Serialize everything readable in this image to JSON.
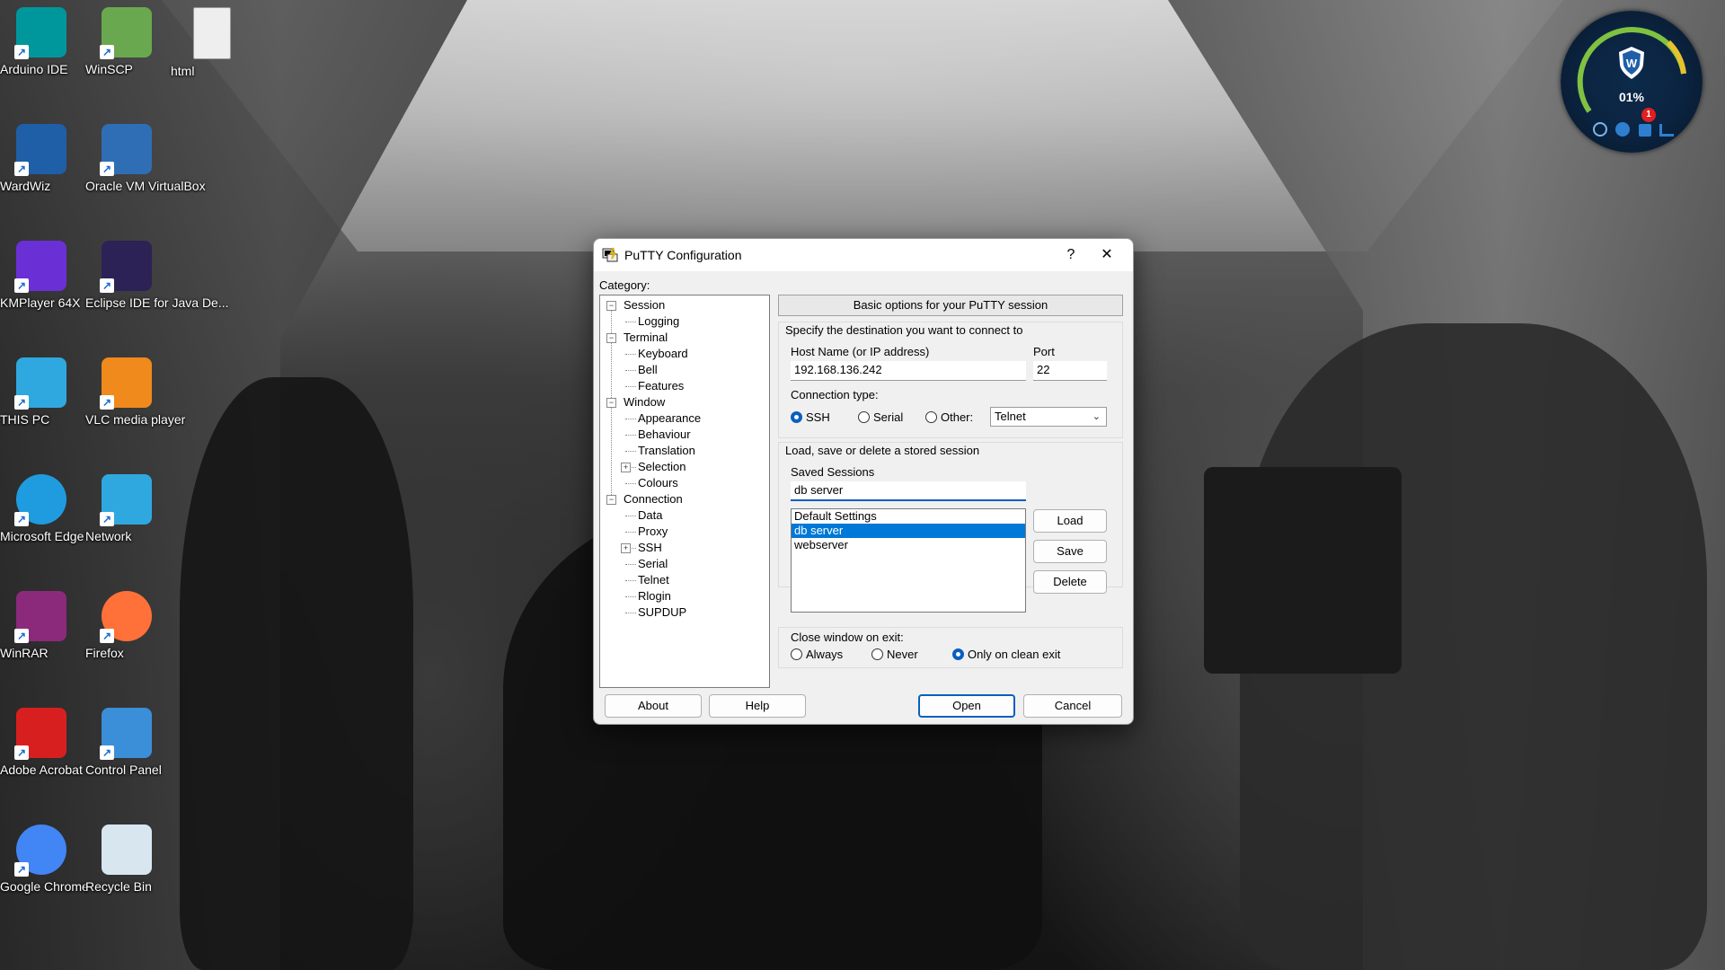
{
  "desktop": {
    "icons": [
      {
        "label": "Arduino IDE",
        "icon": "arduino-icon",
        "color": "#00979c"
      },
      {
        "label": "WinSCP",
        "icon": "winscp-icon",
        "color": "#6aa84f"
      },
      {
        "label": "html",
        "icon": "file-icon",
        "color": "#eeeeee"
      },
      {
        "label": "WardWiz",
        "icon": "wardwiz-shield-icon",
        "color": "#1f5fa8"
      },
      {
        "label": "Oracle VM VirtualBox",
        "icon": "virtualbox-icon",
        "color": "#2f6eb5"
      },
      {
        "label": "KMPlayer 64X",
        "icon": "kmplayer-icon",
        "color": "#6b2fd6"
      },
      {
        "label": "Eclipse IDE for Java De...",
        "icon": "eclipse-icon",
        "color": "#2c2255"
      },
      {
        "label": "THIS PC",
        "icon": "monitor-icon",
        "color": "#2fa8e0"
      },
      {
        "label": "VLC media player",
        "icon": "vlc-cone-icon",
        "color": "#f08a1c"
      },
      {
        "label": "Microsoft Edge",
        "icon": "edge-icon",
        "color": "#1f9be0"
      },
      {
        "label": "Network",
        "icon": "network-icon",
        "color": "#2fa8e0"
      },
      {
        "label": "WinRAR",
        "icon": "winrar-icon",
        "color": "#8b2a7a"
      },
      {
        "label": "Firefox",
        "icon": "firefox-icon",
        "color": "#ff7139"
      },
      {
        "label": "Adobe Acrobat",
        "icon": "acrobat-icon",
        "color": "#d81f1f"
      },
      {
        "label": "Control Panel",
        "icon": "control-panel-icon",
        "color": "#3a8fd8"
      },
      {
        "label": "Google Chrome",
        "icon": "chrome-icon",
        "color": "#4285f4"
      },
      {
        "label": "Recycle Bin",
        "icon": "recycle-bin-icon",
        "color": "#d8e6f0"
      }
    ],
    "shortcut_arrow": "↗"
  },
  "widget": {
    "percent": "01%",
    "badge": "1",
    "icons": [
      "scan-icon",
      "update-icon",
      "lock-icon",
      "chart-icon"
    ]
  },
  "putty": {
    "title": "PuTTY Configuration",
    "help_glyph": "?",
    "close_glyph": "✕",
    "category_label": "Category:",
    "tree": [
      {
        "label": "Session",
        "level": 0,
        "expander": "−"
      },
      {
        "label": "Logging",
        "level": 1
      },
      {
        "label": "Terminal",
        "level": 0,
        "expander": "−"
      },
      {
        "label": "Keyboard",
        "level": 1
      },
      {
        "label": "Bell",
        "level": 1
      },
      {
        "label": "Features",
        "level": 1
      },
      {
        "label": "Window",
        "level": 0,
        "expander": "−"
      },
      {
        "label": "Appearance",
        "level": 1
      },
      {
        "label": "Behaviour",
        "level": 1
      },
      {
        "label": "Translation",
        "level": 1
      },
      {
        "label": "Selection",
        "level": 1,
        "expander": "+"
      },
      {
        "label": "Colours",
        "level": 1
      },
      {
        "label": "Connection",
        "level": 0,
        "expander": "−"
      },
      {
        "label": "Data",
        "level": 1
      },
      {
        "label": "Proxy",
        "level": 1
      },
      {
        "label": "SSH",
        "level": 1,
        "expander": "+"
      },
      {
        "label": "Serial",
        "level": 1
      },
      {
        "label": "Telnet",
        "level": 1
      },
      {
        "label": "Rlogin",
        "level": 1
      },
      {
        "label": "SUPDUP",
        "level": 1
      }
    ],
    "header": "Basic options for your PuTTY session",
    "dest_group": "Specify the destination you want to connect to",
    "host_label": "Host Name (or IP address)",
    "host_value": "192.168.136.242",
    "port_label": "Port",
    "port_value": "22",
    "conn_type_label": "Connection type:",
    "conn_types": [
      "SSH",
      "Serial",
      "Other:"
    ],
    "conn_selected": "SSH",
    "other_protocol": "Telnet",
    "sessions_group": "Load, save or delete a stored session",
    "saved_sessions_label": "Saved Sessions",
    "saved_sessions_value": "db server",
    "sessions": [
      "Default Settings",
      "db server",
      "webserver"
    ],
    "selected_session": "db server",
    "load": "Load",
    "save": "Save",
    "delete": "Delete",
    "close_label": "Close window on exit:",
    "close_options": [
      "Always",
      "Never",
      "Only on clean exit"
    ],
    "close_selected": "Only on clean exit",
    "about": "About",
    "help": "Help",
    "open": "Open",
    "cancel": "Cancel",
    "accent": "#0a5fbf"
  }
}
